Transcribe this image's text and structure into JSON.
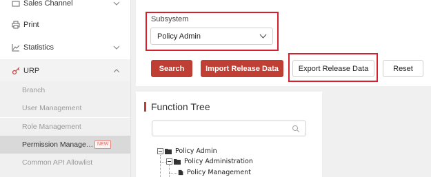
{
  "sidebar": {
    "top_item": {
      "label": "Sales Channel"
    },
    "print": {
      "label": "Print",
      "icon": "printer-icon"
    },
    "statistics": {
      "label": "Statistics",
      "icon": "line-chart-icon"
    },
    "urp": {
      "label": "URP",
      "icon": "key-icon"
    },
    "sub_items": [
      {
        "label": "Branch"
      },
      {
        "label": "User Management"
      },
      {
        "label": "Role Management"
      },
      {
        "label": "Permission Manage…",
        "badge": "NEW",
        "active": true
      },
      {
        "label": "Common API Allowlist"
      }
    ]
  },
  "filter": {
    "subsystem_label": "Subsystem",
    "subsystem_value": "Policy Admin"
  },
  "buttons": {
    "search": "Search",
    "import": "Import Release Data",
    "export": "Export Release Data",
    "reset": "Reset"
  },
  "function_tree": {
    "title": "Function Tree",
    "search_placeholder": "",
    "nodes": [
      "Policy Admin",
      "Policy Administration",
      "Policy Management"
    ]
  },
  "colors": {
    "accent": "#c03f34",
    "highlight_border": "#d5202f"
  }
}
